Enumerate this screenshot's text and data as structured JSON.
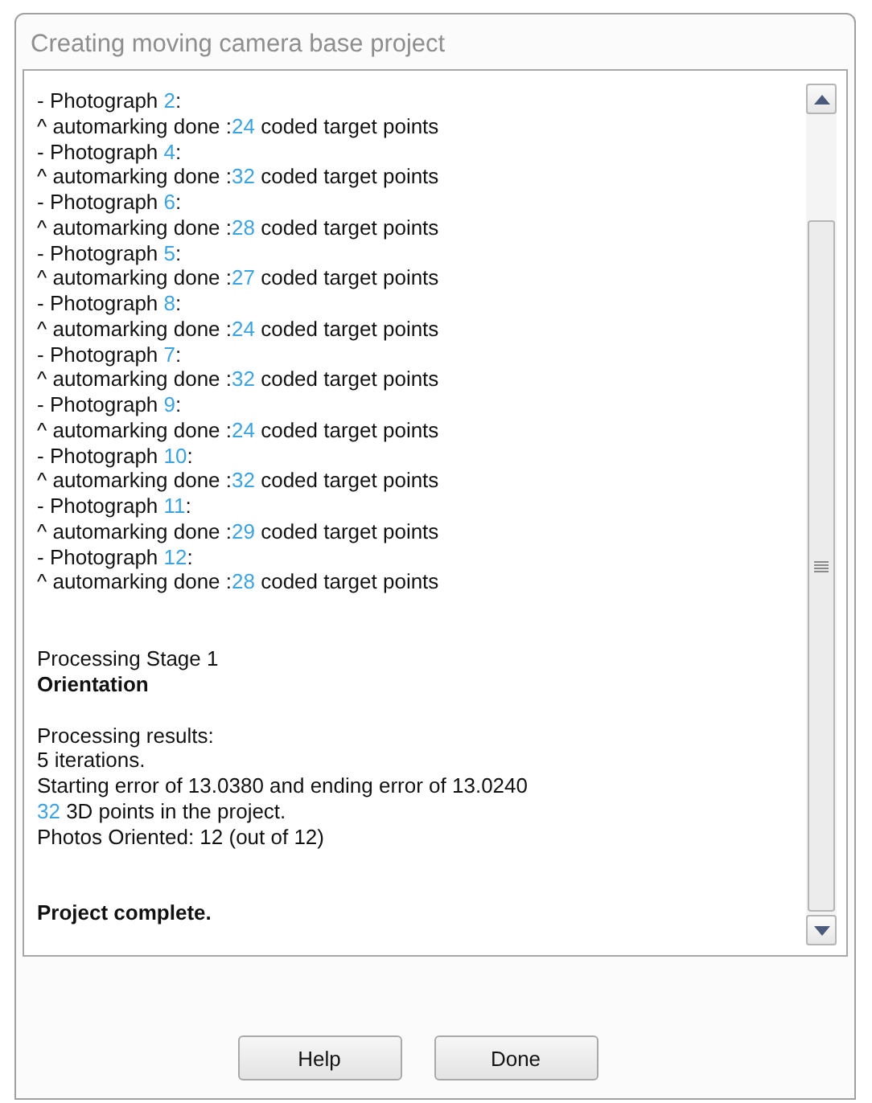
{
  "window": {
    "title": "Creating moving camera base project"
  },
  "log": {
    "sections": [
      {
        "kind": "log",
        "lines": [
          {
            "bold": false,
            "segments": [
              {
                "text": "- Photograph ",
                "accent": false
              },
              {
                "text": "2",
                "accent": true
              },
              {
                "text": ":",
                "accent": false
              }
            ]
          },
          {
            "bold": false,
            "segments": [
              {
                "text": "^ automarking done :",
                "accent": false
              },
              {
                "text": "24",
                "accent": true
              },
              {
                "text": " coded target points",
                "accent": false
              }
            ]
          },
          {
            "bold": false,
            "segments": [
              {
                "text": "- Photograph ",
                "accent": false
              },
              {
                "text": "4",
                "accent": true
              },
              {
                "text": ":",
                "accent": false
              }
            ]
          },
          {
            "bold": false,
            "segments": [
              {
                "text": "^ automarking done :",
                "accent": false
              },
              {
                "text": "32",
                "accent": true
              },
              {
                "text": " coded target points",
                "accent": false
              }
            ]
          },
          {
            "bold": false,
            "segments": [
              {
                "text": "- Photograph ",
                "accent": false
              },
              {
                "text": "6",
                "accent": true
              },
              {
                "text": ":",
                "accent": false
              }
            ]
          },
          {
            "bold": false,
            "segments": [
              {
                "text": "^ automarking done :",
                "accent": false
              },
              {
                "text": "28",
                "accent": true
              },
              {
                "text": " coded target points",
                "accent": false
              }
            ]
          },
          {
            "bold": false,
            "segments": [
              {
                "text": "- Photograph ",
                "accent": false
              },
              {
                "text": "5",
                "accent": true
              },
              {
                "text": ":",
                "accent": false
              }
            ]
          },
          {
            "bold": false,
            "segments": [
              {
                "text": "^ automarking done :",
                "accent": false
              },
              {
                "text": "27",
                "accent": true
              },
              {
                "text": " coded target points",
                "accent": false
              }
            ]
          },
          {
            "bold": false,
            "segments": [
              {
                "text": "- Photograph ",
                "accent": false
              },
              {
                "text": "8",
                "accent": true
              },
              {
                "text": ":",
                "accent": false
              }
            ]
          },
          {
            "bold": false,
            "segments": [
              {
                "text": "^ automarking done :",
                "accent": false
              },
              {
                "text": "24",
                "accent": true
              },
              {
                "text": " coded target points",
                "accent": false
              }
            ]
          },
          {
            "bold": false,
            "segments": [
              {
                "text": "- Photograph ",
                "accent": false
              },
              {
                "text": "7",
                "accent": true
              },
              {
                "text": ":",
                "accent": false
              }
            ]
          },
          {
            "bold": false,
            "segments": [
              {
                "text": "^ automarking done :",
                "accent": false
              },
              {
                "text": "32",
                "accent": true
              },
              {
                "text": " coded target points",
                "accent": false
              }
            ]
          },
          {
            "bold": false,
            "segments": [
              {
                "text": "- Photograph ",
                "accent": false
              },
              {
                "text": "9",
                "accent": true
              },
              {
                "text": ":",
                "accent": false
              }
            ]
          },
          {
            "bold": false,
            "segments": [
              {
                "text": "^ automarking done :",
                "accent": false
              },
              {
                "text": "24",
                "accent": true
              },
              {
                "text": " coded target points",
                "accent": false
              }
            ]
          },
          {
            "bold": false,
            "segments": [
              {
                "text": "- Photograph ",
                "accent": false
              },
              {
                "text": "10",
                "accent": true
              },
              {
                "text": ":",
                "accent": false
              }
            ]
          },
          {
            "bold": false,
            "segments": [
              {
                "text": "^ automarking done :",
                "accent": false
              },
              {
                "text": "32",
                "accent": true
              },
              {
                "text": " coded target points",
                "accent": false
              }
            ]
          },
          {
            "bold": false,
            "segments": [
              {
                "text": "- Photograph ",
                "accent": false
              },
              {
                "text": "11",
                "accent": true
              },
              {
                "text": ":",
                "accent": false
              }
            ]
          },
          {
            "bold": false,
            "segments": [
              {
                "text": "^ automarking done :",
                "accent": false
              },
              {
                "text": "29",
                "accent": true
              },
              {
                "text": " coded target points",
                "accent": false
              }
            ]
          },
          {
            "bold": false,
            "segments": [
              {
                "text": "- Photograph ",
                "accent": false
              },
              {
                "text": "12",
                "accent": true
              },
              {
                "text": ":",
                "accent": false
              }
            ]
          },
          {
            "bold": false,
            "segments": [
              {
                "text": "^ automarking done :",
                "accent": false
              },
              {
                "text": "28",
                "accent": true
              },
              {
                "text": " coded target points",
                "accent": false
              }
            ]
          }
        ]
      },
      {
        "kind": "stage",
        "lines": [
          {
            "bold": false,
            "segments": [
              {
                "text": "Processing Stage 1",
                "accent": false
              }
            ]
          },
          {
            "bold": true,
            "segments": [
              {
                "text": "Orientation",
                "accent": false
              }
            ]
          }
        ]
      },
      {
        "kind": "results",
        "lines": [
          {
            "bold": false,
            "segments": [
              {
                "text": "Processing results:",
                "accent": false
              }
            ]
          },
          {
            "bold": false,
            "segments": [
              {
                "text": "5 iterations.",
                "accent": false
              }
            ]
          },
          {
            "bold": false,
            "segments": [
              {
                "text": "Starting error of 13.0380 and ending error of 13.0240",
                "accent": false
              }
            ]
          },
          {
            "bold": false,
            "segments": [
              {
                "text": "32",
                "accent": true
              },
              {
                "text": " 3D points in the project.",
                "accent": false
              }
            ]
          },
          {
            "bold": false,
            "segments": [
              {
                "text": "Photos Oriented: 12 (out of 12)",
                "accent": false
              }
            ]
          }
        ]
      },
      {
        "kind": "summary",
        "lines": [
          {
            "bold": true,
            "segments": [
              {
                "text": "Project complete.",
                "accent": false
              }
            ]
          }
        ]
      }
    ]
  },
  "buttons": [
    {
      "label": "Help"
    },
    {
      "label": "Done"
    }
  ]
}
